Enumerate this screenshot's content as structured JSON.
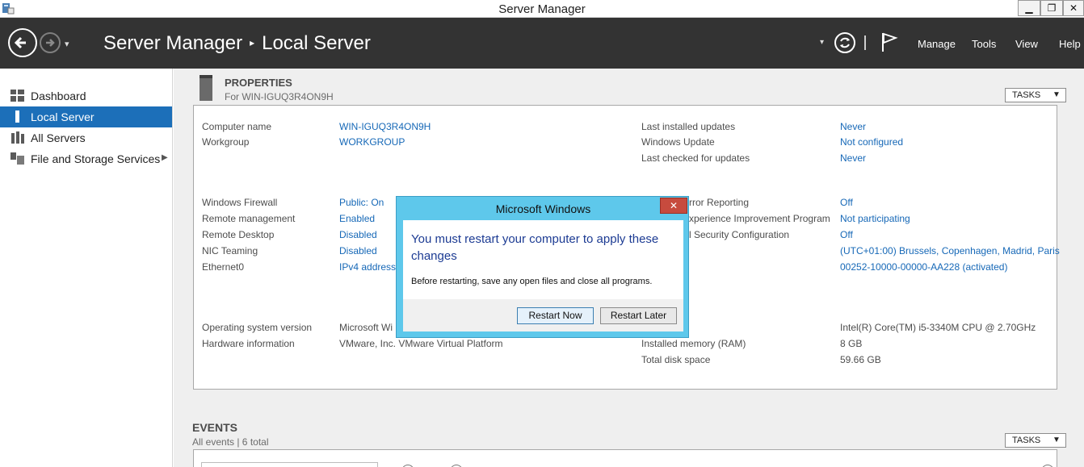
{
  "window": {
    "title": "Server Manager",
    "min_glyph": "▁",
    "max_glyph": "❐",
    "close_glyph": "✕"
  },
  "header": {
    "breadcrumb_app": "Server Manager",
    "breadcrumb_sep": "▸",
    "breadcrumb_page": "Local Server",
    "nav_dropdown": "▾",
    "menu": {
      "manage": "Manage",
      "tools": "Tools",
      "view": "View",
      "help": "Help"
    }
  },
  "sidebar": {
    "items": [
      {
        "label": "Dashboard",
        "icon": "dashboard-icon"
      },
      {
        "label": "Local Server",
        "icon": "local-server-icon",
        "active": true
      },
      {
        "label": "All Servers",
        "icon": "all-servers-icon"
      },
      {
        "label": "File and Storage Services",
        "icon": "storage-icon",
        "chevron": "▶"
      }
    ]
  },
  "properties": {
    "title": "PROPERTIES",
    "subtitle": "For WIN-IGUQ3R4ON9H",
    "tasks_label": "TASKS",
    "tasks_arrow": "▼",
    "left": [
      {
        "label": "Computer name",
        "value": "WIN-IGUQ3R4ON9H"
      },
      {
        "label": "Workgroup",
        "value": "WORKGROUP"
      },
      {
        "label": "Windows Firewall",
        "value": "Public: On"
      },
      {
        "label": "Remote management",
        "value": "Enabled"
      },
      {
        "label": "Remote Desktop",
        "value": "Disabled"
      },
      {
        "label": "NIC Teaming",
        "value": "Disabled"
      },
      {
        "label": "Ethernet0",
        "value": "IPv4 address"
      },
      {
        "label": "Operating system version",
        "value": "Microsoft Wi"
      },
      {
        "label": "Hardware information",
        "value": "VMware, Inc. VMware Virtual Platform"
      }
    ],
    "right": [
      {
        "label": "Last installed updates",
        "value": "Never"
      },
      {
        "label": "Windows Update",
        "value": "Not configured"
      },
      {
        "label": "Last checked for updates",
        "value": "Never"
      },
      {
        "label": "rror Reporting",
        "value": "Off"
      },
      {
        "label": "xperience Improvement Program",
        "value": "Not participating"
      },
      {
        "label": "l Security Configuration",
        "value": "Off"
      },
      {
        "label": "",
        "value": "(UTC+01:00) Brussels, Copenhagen, Madrid, Paris"
      },
      {
        "label": "",
        "value": "00252-10000-00000-AA228 (activated)"
      },
      {
        "label": "",
        "value": "Intel(R) Core(TM) i5-3340M CPU @ 2.70GHz"
      },
      {
        "label": "Installed memory (RAM)",
        "value": "8 GB"
      },
      {
        "label": "Total disk space",
        "value": "59.66 GB"
      }
    ]
  },
  "events": {
    "title": "EVENTS",
    "subtitle": "All events | 6 total",
    "tasks_label": "TASKS",
    "tasks_arrow": "▼"
  },
  "dialog": {
    "title": "Microsoft Windows",
    "close_glyph": "✕",
    "message": "You must restart your computer to apply these changes",
    "detail": "Before restarting, save any open files and close all programs.",
    "restart_now": "Restart Now",
    "restart_later": "Restart Later"
  }
}
